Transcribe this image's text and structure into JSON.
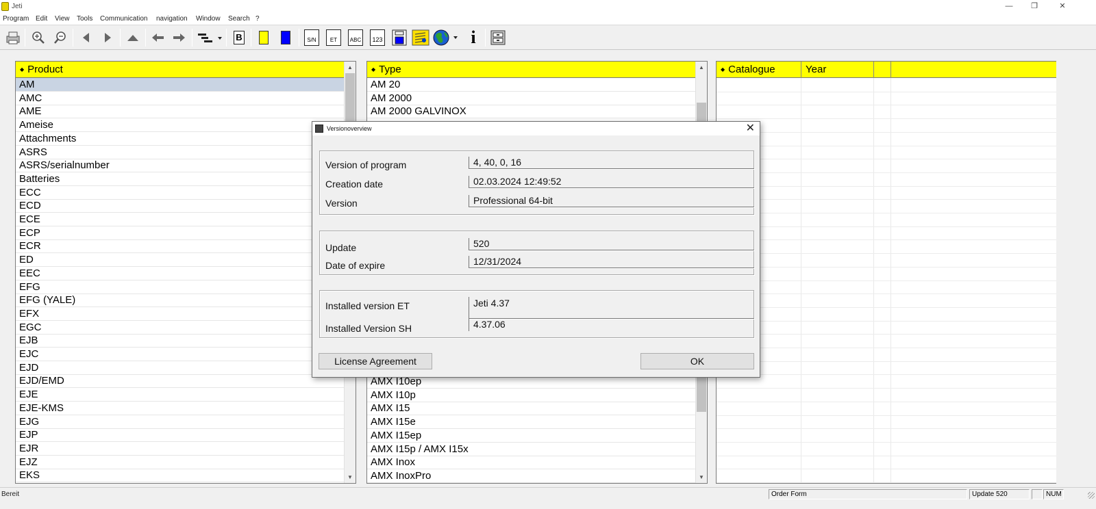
{
  "window": {
    "title": "Jeti"
  },
  "menu": [
    "Program",
    "Edit",
    "View",
    "Tools",
    "Communication",
    "navigation",
    "Window",
    "Search",
    "?"
  ],
  "toolbar": {
    "icons": [
      "print-icon",
      "zoom-in-icon",
      "zoom-out-icon",
      "prev-triangle-icon",
      "next-triangle-icon",
      "up-triangle-icon",
      "back-arrow-icon",
      "forward-arrow-icon",
      "tree-view-icon",
      "bookmark-b-icon",
      "yellow-color-icon",
      "blue-color-icon",
      "serial-number-icon",
      "et-icon",
      "abc-icon",
      "number-123-icon",
      "save-icon",
      "yellow-book-icon",
      "globe-icon",
      "info-icon",
      "cabinet-icon"
    ],
    "sn_label": "S/N",
    "et_label": "ET",
    "abc_label": "ABC",
    "num_label": "123",
    "b_label": "B",
    "info_label": "i"
  },
  "product_panel": {
    "header": "Product",
    "items": [
      "AM",
      "AMC",
      "AME",
      "Ameise",
      "Attachments",
      "ASRS",
      "ASRS/serialnumber",
      "Batteries",
      "ECC",
      "ECD",
      "ECE",
      "ECP",
      "ECR",
      "ED",
      "EEC",
      "EFG",
      "EFG (YALE)",
      "EFX",
      "EGC",
      "EJB",
      "EJC",
      "EJD",
      "EJD/EMD",
      "EJE",
      "EJE-KMS",
      "EJG",
      "EJP",
      "EJR",
      "EJZ",
      "EKS"
    ],
    "selected_index": 0
  },
  "type_panel": {
    "header": "Type",
    "items_top": [
      "AM 20",
      "AM 2000",
      "AM 2000 GALVINOX"
    ],
    "items_bottom": [
      "AMX I10ep",
      "AMX I10p",
      "AMX I15",
      "AMX I15e",
      "AMX I15ep",
      "AMX I15p / AMX I15x",
      "AMX Inox",
      "AMX InoxPro"
    ]
  },
  "catalogue_panel": {
    "headers": [
      "Catalogue",
      "Year",
      ""
    ]
  },
  "dialog": {
    "title": "Versionoverview",
    "close": "✕",
    "group1": [
      {
        "label": "Version of program",
        "value": "4, 40, 0, 16"
      },
      {
        "label": "Creation date",
        "value": "02.03.2024 12:49:52"
      },
      {
        "label": "Version",
        "value": "Professional 64-bit"
      }
    ],
    "group2": [
      {
        "label": "Update",
        "value": "520"
      },
      {
        "label": "Date of expire",
        "value": "12/31/2024"
      }
    ],
    "group3": [
      {
        "label": "Installed version ET",
        "value": "Jeti 4.37"
      },
      {
        "label": "Installed Version SH",
        "value": "4.37.06"
      }
    ],
    "license_button": "License Agreement",
    "ok_button": "OK"
  },
  "status": {
    "left": "Bereit",
    "order": "Order Form",
    "update": "Update 520",
    "num": "NUM"
  },
  "colors": {
    "header_yellow": "#ffff00",
    "selection": "#c9d4e3",
    "toolbar_blue": "#0000ff"
  }
}
